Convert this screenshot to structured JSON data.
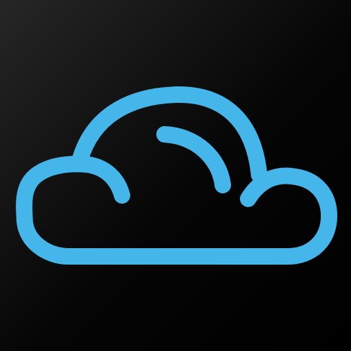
{
  "icon": {
    "name": "cloud-icon",
    "stroke_color": "#45b6ea",
    "background_color": "#0a0a0a"
  }
}
